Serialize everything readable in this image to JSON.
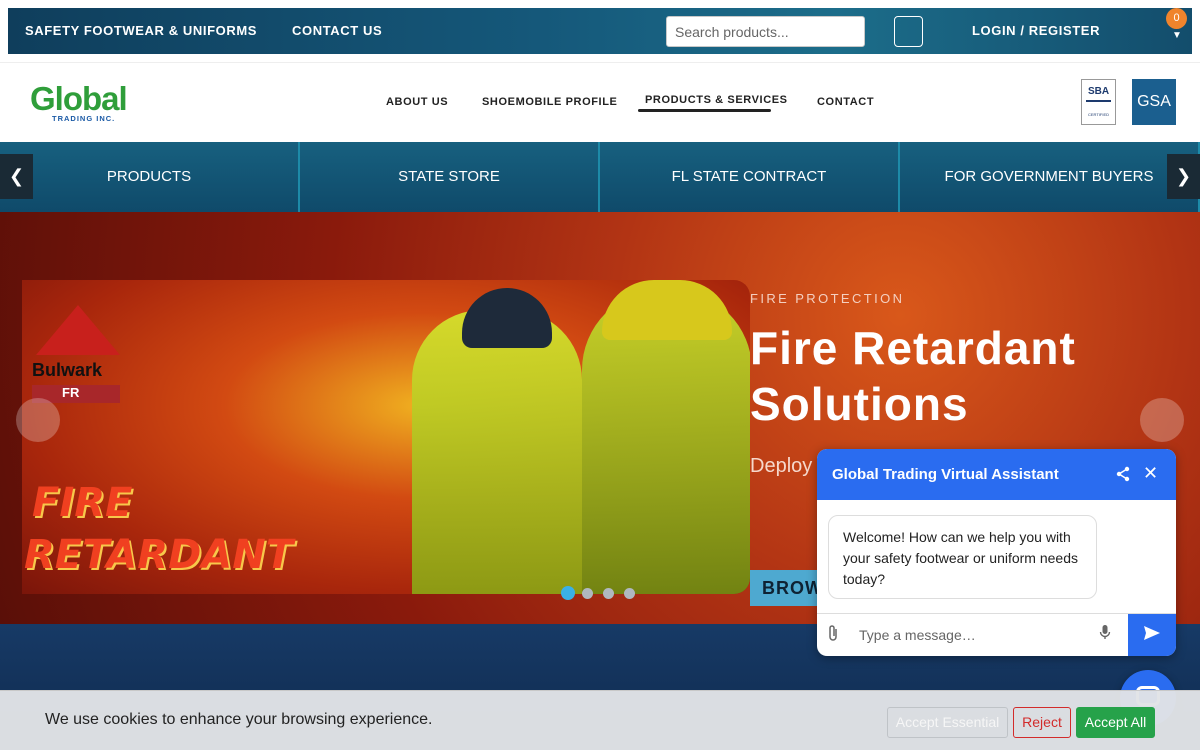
{
  "topbar": {
    "links": [
      "SAFETY FOOTWEAR & UNIFORMS",
      "CONTACT US"
    ],
    "search_placeholder": "Search products...",
    "login_label": "LOGIN / REGISTER",
    "cart_count": "0"
  },
  "header": {
    "logo_word": "Global",
    "logo_sub": "TRADING INC.",
    "nav": [
      "ABOUT US",
      "SHOEMOBILE PROFILE",
      "PRODUCTS & SERVICES",
      "CONTACT"
    ],
    "active_nav": "PRODUCTS & SERVICES",
    "badge_sba": "SBA",
    "badge_sba_sub": "CERTIFIED",
    "badge_gsa": "GSA"
  },
  "categories": [
    "PRODUCTS",
    "STATE STORE",
    "FL STATE CONTRACT",
    "FOR GOVERNMENT BUYERS"
  ],
  "category_arrows": {
    "prev": "❮",
    "next": "❯"
  },
  "hero": {
    "brand_text": "Bulwark",
    "brand_sub": "FR",
    "image_text_1": "FIRE",
    "image_text_2": "RETARDANT",
    "eyebrow": "FIRE PROTECTION",
    "title_line1": "Fire Retardant",
    "title_line2": "Solutions",
    "body": "Deploy identifie support",
    "button": "BROW",
    "active_slide": 1,
    "slide_count": 4
  },
  "chat": {
    "title": "Global Trading Virtual Assistant",
    "message": "Welcome! How can we help you with your safety footwear or uniform needs today?",
    "input_placeholder": "Type a message…"
  },
  "cookie": {
    "text": "We use cookies to enhance your browsing experience.",
    "accept_essential": "Accept Essential",
    "reject": "Reject",
    "accept_all": "Accept All"
  },
  "colors": {
    "accent": "#2a6cf0",
    "cart_badge": "#f0842c",
    "accept_green": "#26a24a",
    "reject_red": "#d22b2b"
  },
  "icons": [
    "user-icon",
    "chevron-down-icon",
    "share-icon",
    "close-icon",
    "paperclip-icon",
    "mic-icon",
    "send-icon",
    "chat-icon"
  ]
}
